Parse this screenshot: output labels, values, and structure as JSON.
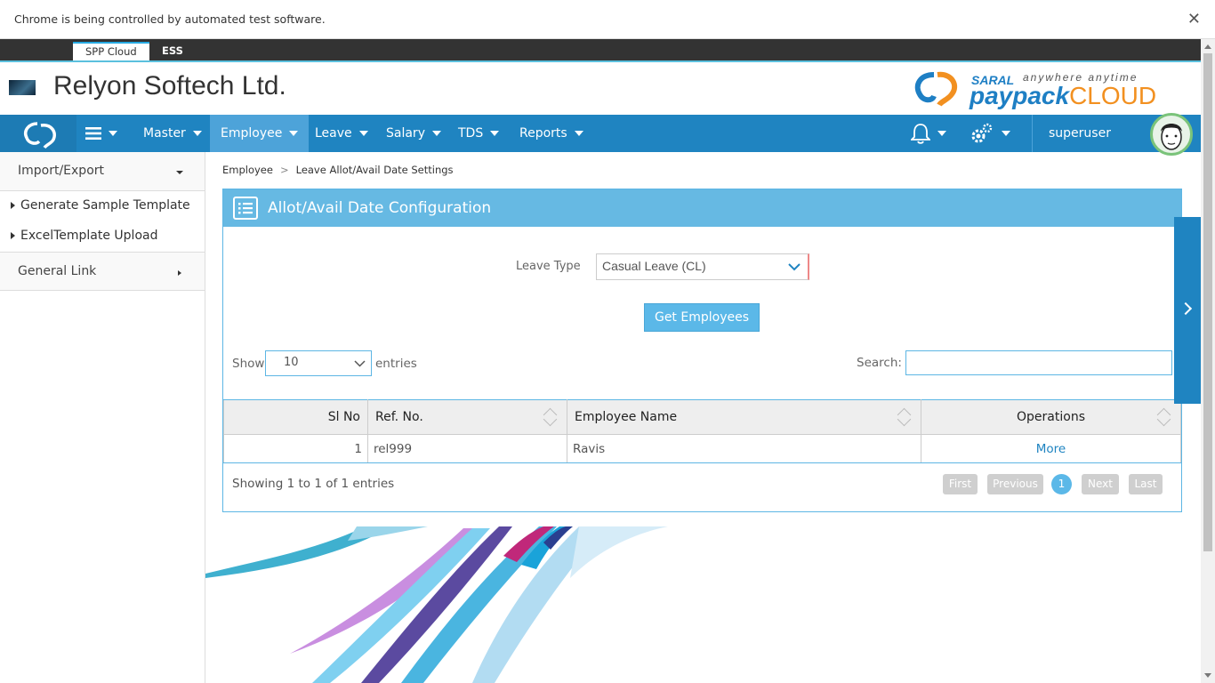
{
  "browser": {
    "infobar_text": "Chrome is being controlled by automated test software.",
    "close_symbol": "✕"
  },
  "app_tabs": [
    {
      "label": "SPP Cloud",
      "active": true
    },
    {
      "label": "ESS",
      "active": false
    }
  ],
  "header": {
    "company": "Relyon Softech Ltd.",
    "brand_saral": "SARAL",
    "brand_tagline": "anywhere anytime",
    "brand_paypack": "paypack",
    "brand_cloud": "CLOUD"
  },
  "nav": {
    "items": [
      {
        "label": "Master"
      },
      {
        "label": "Employee",
        "active": true
      },
      {
        "label": "Leave"
      },
      {
        "label": "Salary"
      },
      {
        "label": "TDS"
      },
      {
        "label": "Reports"
      }
    ],
    "user": "superuser"
  },
  "sidebar": {
    "section1": "Import/Export",
    "sub_items": [
      "Generate Sample Template",
      "ExcelTemplate Upload"
    ],
    "section2": "General Link"
  },
  "breadcrumb": {
    "parent": "Employee",
    "current": "Leave Allot/Avail Date Settings"
  },
  "panel": {
    "title": "Allot/Avail Date Configuration",
    "leave_type_label": "Leave Type",
    "leave_type_value": "Casual Leave (CL)",
    "get_button": "Get Employees",
    "show_label": "Show",
    "show_value": "10",
    "entries_label": "entries",
    "search_label": "Search:",
    "search_value": ""
  },
  "table": {
    "headers": [
      "Sl No",
      "Ref. No.",
      "Employee Name",
      "Operations"
    ],
    "rows": [
      {
        "sl": "1",
        "ref": "rel999",
        "name": "Ravis",
        "op": "More"
      }
    ]
  },
  "footer": {
    "info": "Showing 1 to 1 of 1 entries",
    "first": "First",
    "previous": "Previous",
    "current_page": "1",
    "next": "Next",
    "last": "Last"
  },
  "colors": {
    "nav_blue": "#1f84c1",
    "active_nav": "#4da3d9",
    "panel_head": "#66b9e3",
    "button": "#5bb8e8"
  }
}
